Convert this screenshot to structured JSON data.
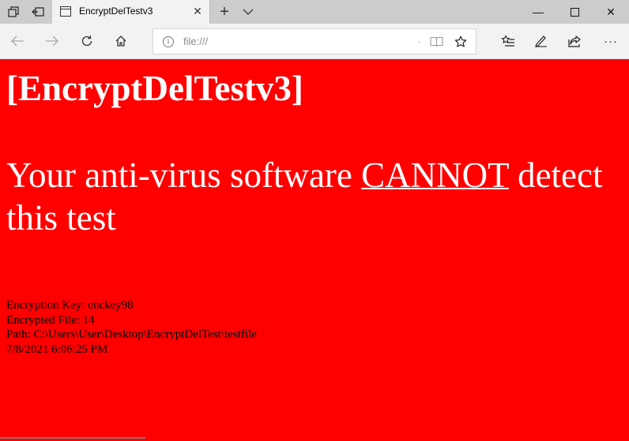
{
  "browser": {
    "tab": {
      "title": "EncryptDelTestv3"
    },
    "address_bar": {
      "url": "file:///",
      "dot": "."
    },
    "icons": {
      "set_aside": "tab-sets-icon",
      "set_tabs_aside": "set-aside-icon",
      "new_tab": "+",
      "tab_list": "chevron-down-icon",
      "close_tab": "✕",
      "minimize": "—",
      "maximize": "☐",
      "close_window": "✕",
      "more": "···"
    }
  },
  "page": {
    "heading": "[EncryptDelTestv3]",
    "warning_prefix": "Your anti-virus software ",
    "warning_emphasis": "CANNOT",
    "warning_suffix": " detect this test",
    "info": {
      "key_line": "Encryption Key: enckey98",
      "files_line": "Encrypted File: 14",
      "path_line": "Path: C:\\Users\\User\\Desktop\\EncryptDelTest\\testfile",
      "date_line": "7/8/2021 6:06:25 PM"
    },
    "colors": {
      "background": "#ff0000",
      "heading_text": "#ffffff",
      "info_text": "#000000"
    }
  }
}
